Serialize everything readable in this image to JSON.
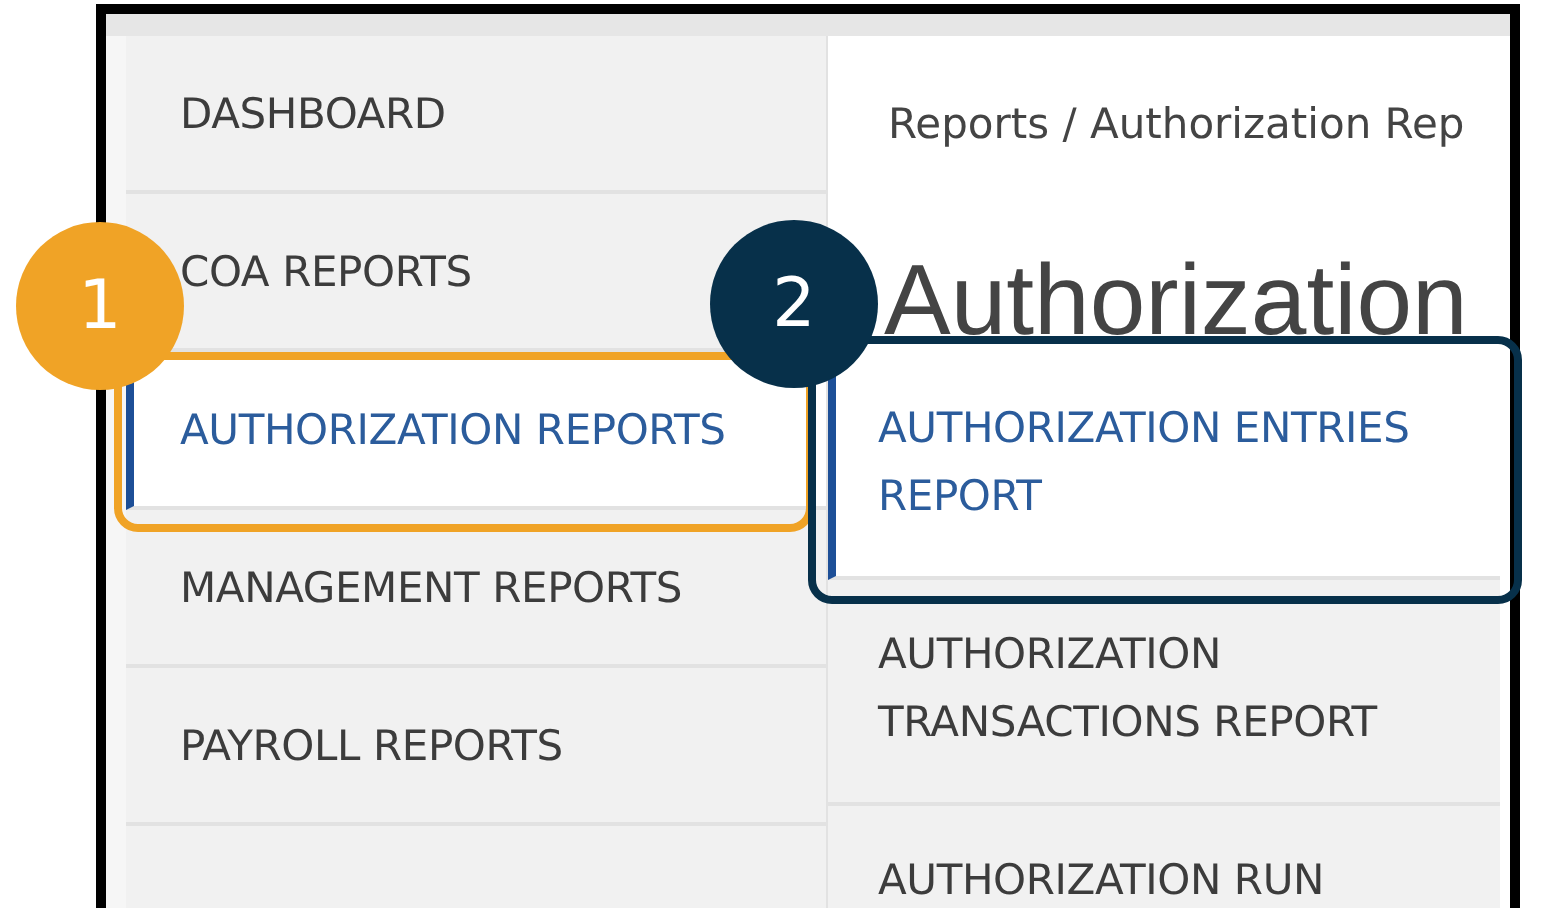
{
  "sidebar": {
    "items": [
      {
        "label": "DASHBOARD",
        "selected": false
      },
      {
        "label": "COA REPORTS",
        "selected": false
      },
      {
        "label": "AUTHORIZATION REPORTS",
        "selected": true
      },
      {
        "label": "MANAGEMENT REPORTS",
        "selected": false
      },
      {
        "label": "PAYROLL REPORTS",
        "selected": false
      }
    ]
  },
  "breadcrumb": "Reports / Authorization Rep",
  "heading": "Authorization",
  "submenu": {
    "items": [
      {
        "label": "AUTHORIZATION ENTRIES REPORT",
        "selected": true
      },
      {
        "label": "AUTHORIZATION TRANSACTIONS REPORT",
        "selected": false
      },
      {
        "label": "AUTHORIZATION RUN",
        "selected": false
      }
    ]
  },
  "callouts": [
    {
      "number": "1",
      "color": "#f0a326"
    },
    {
      "number": "2",
      "color": "#07304a"
    }
  ]
}
